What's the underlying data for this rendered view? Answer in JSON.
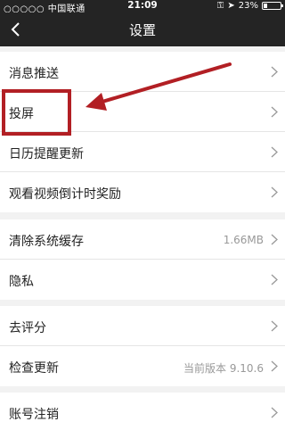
{
  "status": {
    "carrier": "○○○○○ 中国联通",
    "time": "21:09",
    "battery": "23%",
    "battery_level": 0.23
  },
  "nav": {
    "title": "设置"
  },
  "groups": [
    {
      "items": [
        {
          "label": "消息推送"
        },
        {
          "label": "投屏"
        },
        {
          "label": "日历提醒更新"
        },
        {
          "label": "观看视频倒计时奖励"
        }
      ]
    },
    {
      "items": [
        {
          "label": "清除系统缓存",
          "value": "1.66MB"
        },
        {
          "label": "隐私"
        }
      ]
    },
    {
      "items": [
        {
          "label": "去评分"
        },
        {
          "label": "检查更新",
          "value": "当前版本 9.10.6"
        }
      ]
    },
    {
      "items": [
        {
          "label": "账号注销"
        }
      ]
    }
  ],
  "colors": {
    "header": "#242424",
    "annotation": "#b21f24"
  }
}
